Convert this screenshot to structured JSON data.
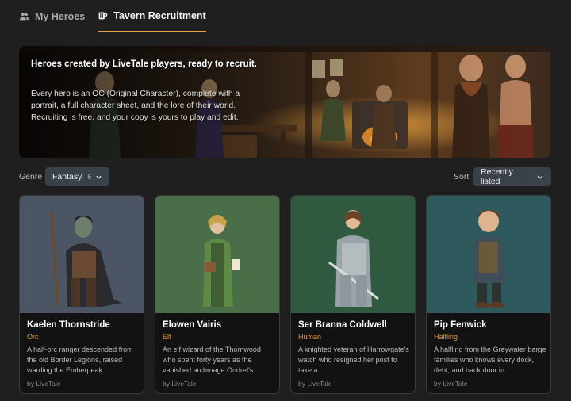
{
  "tabs": [
    {
      "label": "My Heroes",
      "icon": "users-icon",
      "active": false
    },
    {
      "label": "Tavern Recruitment",
      "icon": "mug-icon",
      "active": true
    }
  ],
  "banner": {
    "title": "Heroes created by LiveTale players, ready to recruit.",
    "body": "Every hero is an OC (Original Character), complete with a portrait, a full character sheet, and the lore of their world. Recruiting is free, and your copy is yours to play and edit."
  },
  "filters": {
    "genre_label": "Genre",
    "genre_value": "Fantasy",
    "genre_count": "6",
    "sort_label": "Sort",
    "sort_value": "Recently listed"
  },
  "heroes": [
    {
      "name": "Kaelen Thornstride",
      "race": "Orc",
      "desc": "A half-orc ranger descended from the old Border Legions, raised warding the Emberpeak...",
      "by": "by LiveTale",
      "bg": "#4b5563"
    },
    {
      "name": "Elowen Vairis",
      "race": "Elf",
      "desc": "An elf wizard of the Thornwood who spent forty years as the vanished archmage Ondrel's...",
      "by": "by LiveTale",
      "bg": "#4a6e47"
    },
    {
      "name": "Ser Branna Coldwell",
      "race": "Human",
      "desc": "A knighted veteran of Harrowgate's watch who resigned her post to take a...",
      "by": "by LiveTale",
      "bg": "#2f5a3f"
    },
    {
      "name": "Pip Fenwick",
      "race": "Halfling",
      "desc": "A halfling from the Greywater barge families who knows every dock, debt, and back door in...",
      "by": "by LiveTale",
      "bg": "#2e5a5e"
    }
  ],
  "colors": {
    "accent": "#e6a13c",
    "race_text": "#e39a37",
    "pill_bg": "#3b4149"
  }
}
